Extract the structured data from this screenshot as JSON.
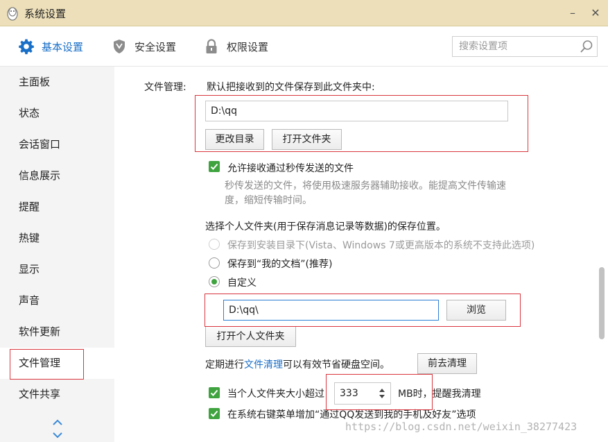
{
  "window": {
    "title": "系统设置",
    "minimize_glyph": "–",
    "close_glyph": "✕"
  },
  "tabs": [
    {
      "label": "基本设置",
      "icon": "gear-icon",
      "active": true
    },
    {
      "label": "安全设置",
      "icon": "shield-icon",
      "active": false
    },
    {
      "label": "权限设置",
      "icon": "lock-icon",
      "active": false
    }
  ],
  "search": {
    "placeholder": "搜索设置项",
    "value": ""
  },
  "sidebar": {
    "items": [
      "主面板",
      "状态",
      "会话窗口",
      "信息展示",
      "提醒",
      "热键",
      "显示",
      "声音",
      "软件更新",
      "文件管理",
      "文件共享"
    ],
    "active": "文件管理"
  },
  "file_mgmt": {
    "section_label": "文件管理:",
    "default_save_label": "默认把接收到的文件保存到此文件夹中:",
    "default_path": "D:\\qq",
    "change_dir_button": "更改目录",
    "open_folder_button": "打开文件夹",
    "flash_transfer": {
      "checked": true,
      "label": "允许接收通过秒传发送的文件",
      "desc_line1": "秒传发送的文件，将使用极速服务器辅助接收。能提高文件传输速",
      "desc_line2": "度，缩短传输时间。"
    },
    "personal_folder_label": "选择个人文件夹(用于保存消息记录等数据)的保存位置。",
    "radio_options": [
      {
        "label": "保存到安装目录下(Vista、Windows 7或更高版本的系统不支持此选项)",
        "disabled": true,
        "selected": false
      },
      {
        "label": "保存到“我的文档”(推荐)",
        "disabled": false,
        "selected": false
      },
      {
        "label": "自定义",
        "disabled": false,
        "selected": true
      }
    ],
    "custom_path": "D:\\qq\\",
    "browse_button": "浏览",
    "open_personal_folder_button": "打开个人文件夹",
    "cleanup": {
      "prefix": "定期进行",
      "link": "文件清理",
      "suffix": "可以有效节省硬盘空间。",
      "button": "前去清理"
    },
    "size_reminder": {
      "checked": true,
      "prefix": "当个人文件夹大小超过",
      "value": "333",
      "suffix": "MB时，提醒我清理"
    },
    "context_menu": {
      "checked": true,
      "label": "在系统右键菜单增加“通过QQ发送到我的手机及好友”选项"
    }
  },
  "watermark": "https://blog.csdn.net/weixin_38277423",
  "colors": {
    "accent": "#1a6fc7",
    "titlebar": "#ecdfb9",
    "check_green": "#3fa33f",
    "highlight_red": "#d9363e"
  }
}
